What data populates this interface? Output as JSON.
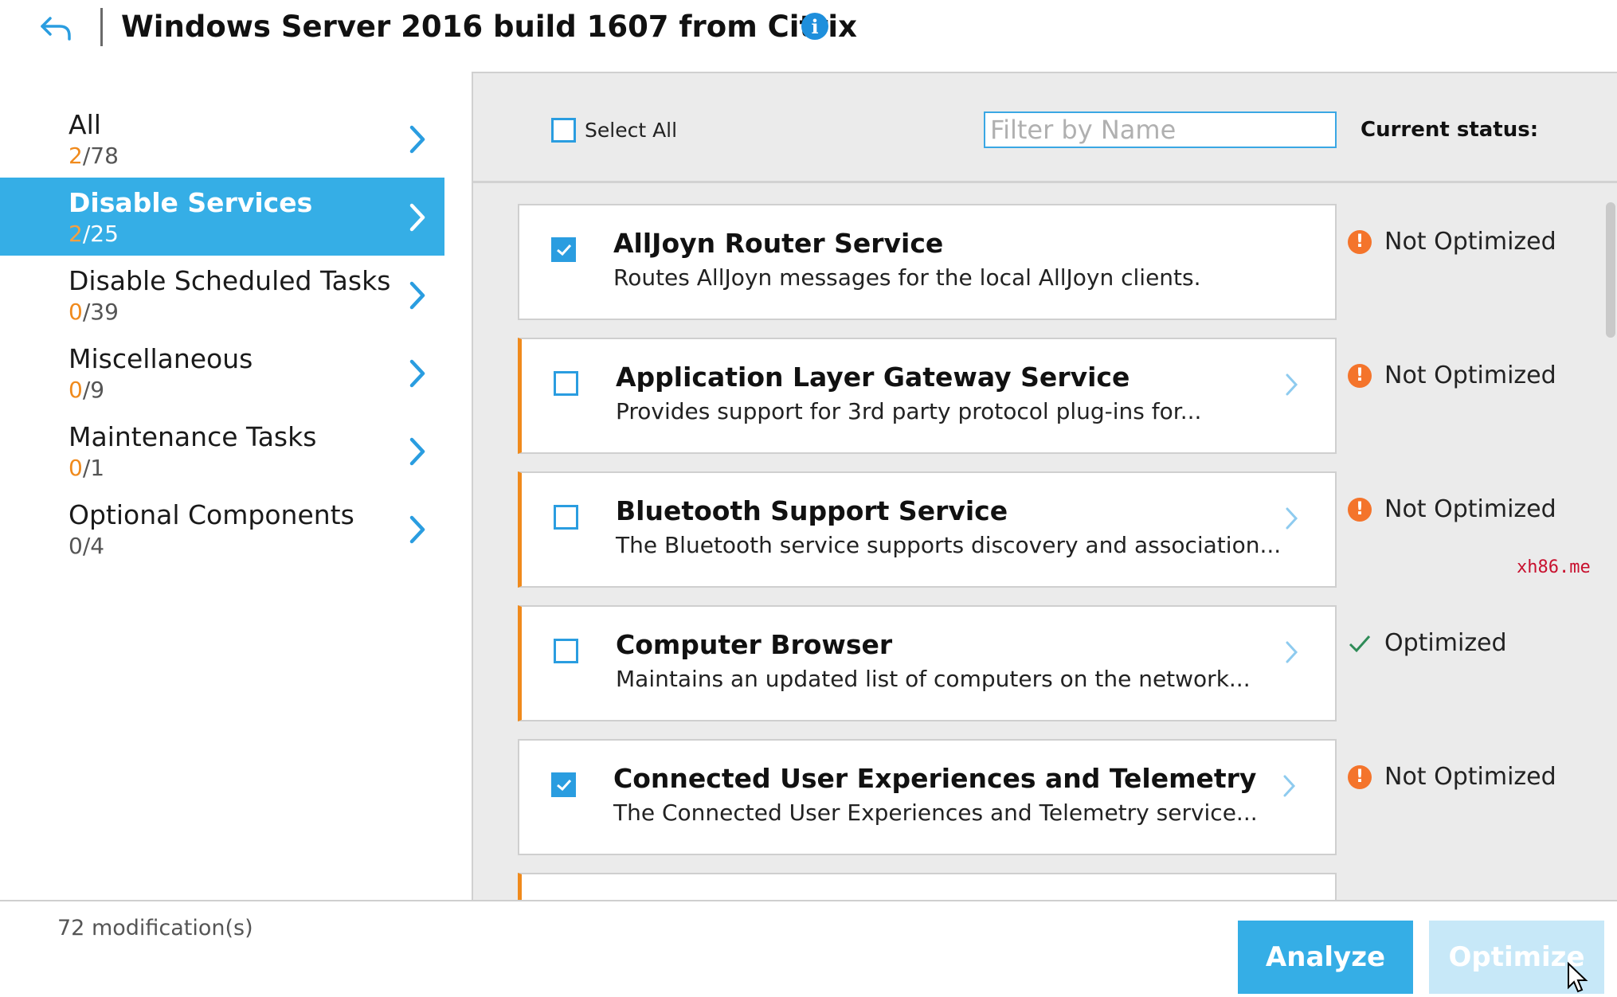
{
  "header": {
    "title": "Windows Server 2016 build 1607 from Citrix",
    "back_icon": "back-arrow-icon",
    "info_icon": "info-icon",
    "info_glyph": "i"
  },
  "sidebar": {
    "items": [
      {
        "label": "All",
        "applied": "2",
        "total": "/78",
        "active": false
      },
      {
        "label": "Disable Services",
        "applied": "2",
        "total": "/25",
        "active": true
      },
      {
        "label": "Disable Scheduled Tasks",
        "applied": "0",
        "total": "/39",
        "active": false
      },
      {
        "label": "Miscellaneous",
        "applied": "0",
        "total": "/9",
        "active": false
      },
      {
        "label": "Maintenance Tasks",
        "applied": "0",
        "total": "/1",
        "active": false
      },
      {
        "label": "Optional Components",
        "applied": "0/4",
        "total": "",
        "active": false
      }
    ]
  },
  "toolbar": {
    "select_all_label": "Select All",
    "filter_placeholder": "Filter by Name",
    "status_header": "Current status:"
  },
  "items": [
    {
      "title": "AllJoyn Router Service",
      "description": "Routes AllJoyn messages for the local AllJoyn clients.",
      "checked": true,
      "has_chevron": false,
      "flagged": false,
      "status": "Not Optimized",
      "status_icon": "warning-icon"
    },
    {
      "title": "Application Layer Gateway Service",
      "description": "Provides support for 3rd party protocol plug-ins for...",
      "checked": false,
      "has_chevron": true,
      "flagged": true,
      "status": "Not Optimized",
      "status_icon": "warning-icon"
    },
    {
      "title": "Bluetooth Support Service",
      "description": "The Bluetooth service supports discovery and association...",
      "checked": false,
      "has_chevron": true,
      "flagged": true,
      "status": "Not Optimized",
      "status_icon": "warning-icon"
    },
    {
      "title": "Computer Browser",
      "description": "Maintains an updated list of computers on the network...",
      "checked": false,
      "has_chevron": true,
      "flagged": true,
      "status": "Optimized",
      "status_icon": "checkmark-icon"
    },
    {
      "title": "Connected User Experiences and Telemetry",
      "description": "The Connected User Experiences and Telemetry service...",
      "checked": true,
      "has_chevron": true,
      "flagged": false,
      "status": "Not Optimized",
      "status_icon": "warning-icon"
    }
  ],
  "watermark": "xh86.me",
  "footer": {
    "modifications": "72 modification(s)",
    "analyze_label": "Analyze",
    "optimize_label": "Optimize"
  },
  "colors": {
    "accent": "#35aee6",
    "warning": "#f4742b",
    "count_highlight": "#f08a1c",
    "optimized": "#2e8b57"
  }
}
